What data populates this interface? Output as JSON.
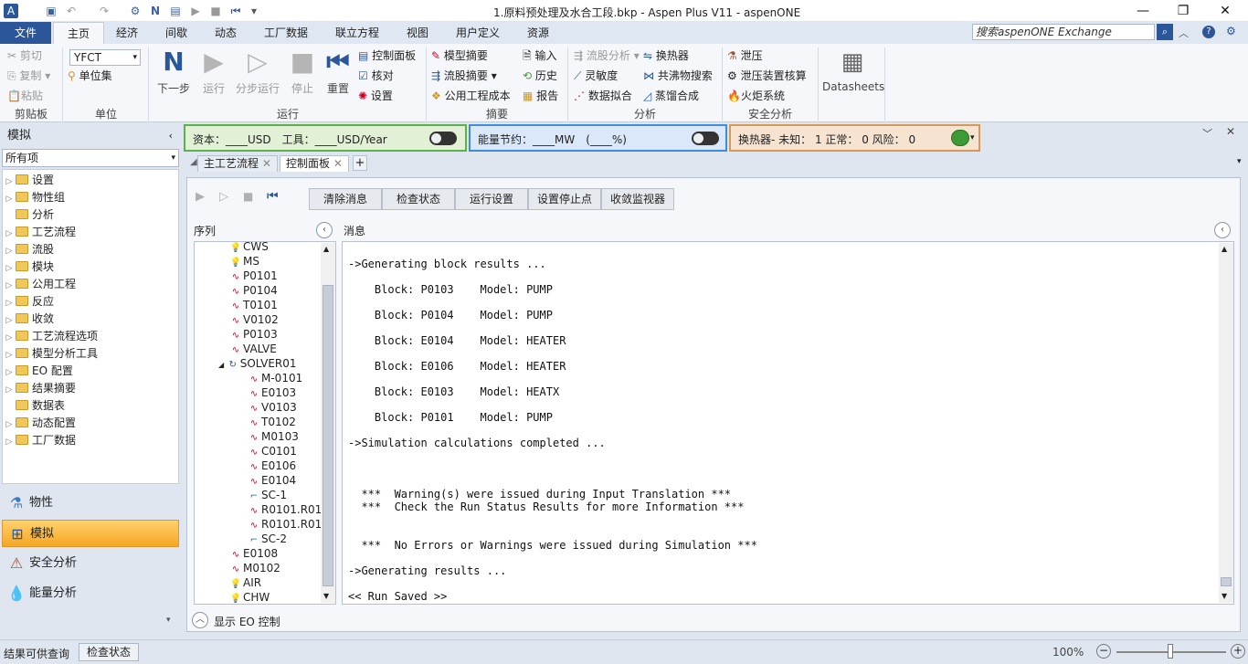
{
  "window": {
    "title": "1.原料预处理及水合工段.bkp - Aspen Plus V11 - aspenONE"
  },
  "menu_tabs": [
    "文件",
    "主页",
    "经济",
    "间歇",
    "动态",
    "工厂数据",
    "联立方程",
    "视图",
    "用户定义",
    "资源"
  ],
  "search": {
    "placeholder": "搜索aspenONE Exchange"
  },
  "ribbon": {
    "clipboard": {
      "cut": "剪切",
      "copy": "复制",
      "paste": "粘贴",
      "label": "剪贴板"
    },
    "units": {
      "value": "YFCT",
      "unit_set": "单位集",
      "label": "单位"
    },
    "run": {
      "next": "下一步",
      "run": "运行",
      "step": "分步运行",
      "stop": "停止",
      "reset": "重置",
      "control_panel": "控制面板",
      "check": "核对",
      "settings": "设置",
      "label": "运行"
    },
    "summary": {
      "model_summary": "模型摘要",
      "stream_summary": "流股摘要",
      "utility_cost": "公用工程成本",
      "input": "输入",
      "history": "历史",
      "report": "报告",
      "label": "摘要"
    },
    "analysis": {
      "stream_analysis": "流股分析",
      "sensitivity": "灵敏度",
      "data_fit": "数据拟合",
      "heat_exchanger": "换热器",
      "azeotrope": "共沸物搜索",
      "distillation": "蒸馏合成",
      "label": "分析"
    },
    "safety": {
      "relief": "泄压",
      "relief_check": "泄压装置核算",
      "flare": "火炬系统",
      "label": "安全分析"
    },
    "datasheets": "Datasheets"
  },
  "status_strip": {
    "capital": "资本：____USD　工具：____USD/Year",
    "energy": "能量节约：____MW　(____%)",
    "exchanger": "换热器- 未知：  1   正常：  0   风险：  0"
  },
  "nav": {
    "header": "模拟",
    "filter": "所有项",
    "tree": [
      {
        "label": "设置",
        "exp": true
      },
      {
        "label": "物性组",
        "exp": true
      },
      {
        "label": "分析",
        "exp": false
      },
      {
        "label": "工艺流程",
        "exp": true
      },
      {
        "label": "流股",
        "exp": true
      },
      {
        "label": "模块",
        "exp": true
      },
      {
        "label": "公用工程",
        "exp": true
      },
      {
        "label": "反应",
        "exp": true
      },
      {
        "label": "收敛",
        "exp": true
      },
      {
        "label": "工艺流程选项",
        "exp": true
      },
      {
        "label": "模型分析工具",
        "exp": true
      },
      {
        "label": "EO 配置",
        "exp": true
      },
      {
        "label": "结果摘要",
        "exp": true
      },
      {
        "label": "数据表",
        "exp": false
      },
      {
        "label": "动态配置",
        "exp": true
      },
      {
        "label": "工厂数据",
        "exp": true
      }
    ],
    "buttons": [
      "物性",
      "模拟",
      "安全分析",
      "能量分析"
    ]
  },
  "doc_tabs": [
    "主工艺流程",
    "控制面板"
  ],
  "panel": {
    "buttons": [
      "清除消息",
      "检查状态",
      "运行设置",
      "设置停止点",
      "收敛监视器"
    ],
    "seq_header": "序列",
    "msg_header": "消息",
    "sequence": [
      {
        "name": "CWS",
        "t": "bulb",
        "lvl": 0
      },
      {
        "name": "MS",
        "t": "bulb",
        "lvl": 0
      },
      {
        "name": "P0101",
        "t": "blk",
        "lvl": 0
      },
      {
        "name": "P0104",
        "t": "blk",
        "lvl": 0
      },
      {
        "name": "T0101",
        "t": "blk",
        "lvl": 0
      },
      {
        "name": "V0102",
        "t": "blk",
        "lvl": 0
      },
      {
        "name": "P0103",
        "t": "blk",
        "lvl": 0
      },
      {
        "name": "VALVE",
        "t": "blk",
        "lvl": 0
      },
      {
        "name": "SOLVER01",
        "t": "loop",
        "lvl": 0
      },
      {
        "name": "M-0101",
        "t": "blk",
        "lvl": 1
      },
      {
        "name": "E0103",
        "t": "blk",
        "lvl": 1
      },
      {
        "name": "V0103",
        "t": "blk",
        "lvl": 1
      },
      {
        "name": "T0102",
        "t": "blk",
        "lvl": 1
      },
      {
        "name": "M0103",
        "t": "blk",
        "lvl": 1
      },
      {
        "name": "C0101",
        "t": "blk",
        "lvl": 1
      },
      {
        "name": "E0106",
        "t": "blk",
        "lvl": 1
      },
      {
        "name": "E0104",
        "t": "blk",
        "lvl": 1
      },
      {
        "name": "SC-1",
        "t": "conv",
        "lvl": 1
      },
      {
        "name": "R0101.R011",
        "t": "blk",
        "lvl": 1
      },
      {
        "name": "R0101.R012",
        "t": "blk",
        "lvl": 1
      },
      {
        "name": "SC-2",
        "t": "conv",
        "lvl": 1
      },
      {
        "name": "E0108",
        "t": "blk",
        "lvl": 0
      },
      {
        "name": "M0102",
        "t": "blk",
        "lvl": 0
      },
      {
        "name": "AIR",
        "t": "bulb",
        "lvl": 0
      },
      {
        "name": "CHW",
        "t": "bulb",
        "lvl": 0
      }
    ],
    "messages": [
      "->Generating block results ...",
      "",
      "    Block: P0103    Model: PUMP",
      "",
      "    Block: P0104    Model: PUMP",
      "",
      "    Block: E0104    Model: HEATER",
      "",
      "    Block: E0106    Model: HEATER",
      "",
      "    Block: E0103    Model: HEATX",
      "",
      "    Block: P0101    Model: PUMP",
      "",
      "->Simulation calculations completed ...",
      "",
      "",
      "",
      "  ***  Warning(s) were issued during Input Translation ***",
      "  ***  Check the Run Status Results for more Information ***",
      "",
      "",
      "  ***  No Errors or Warnings were issued during Simulation ***",
      "",
      "->Generating results ...",
      "",
      "<< Run Saved >>"
    ],
    "eo_control": "显示 EO 控制"
  },
  "statusbar": {
    "text": "结果可供查询",
    "check": "检查状态",
    "zoom": "100%"
  },
  "colors": {
    "accent": "#2b579a",
    "sim_active": "#f6a623"
  }
}
